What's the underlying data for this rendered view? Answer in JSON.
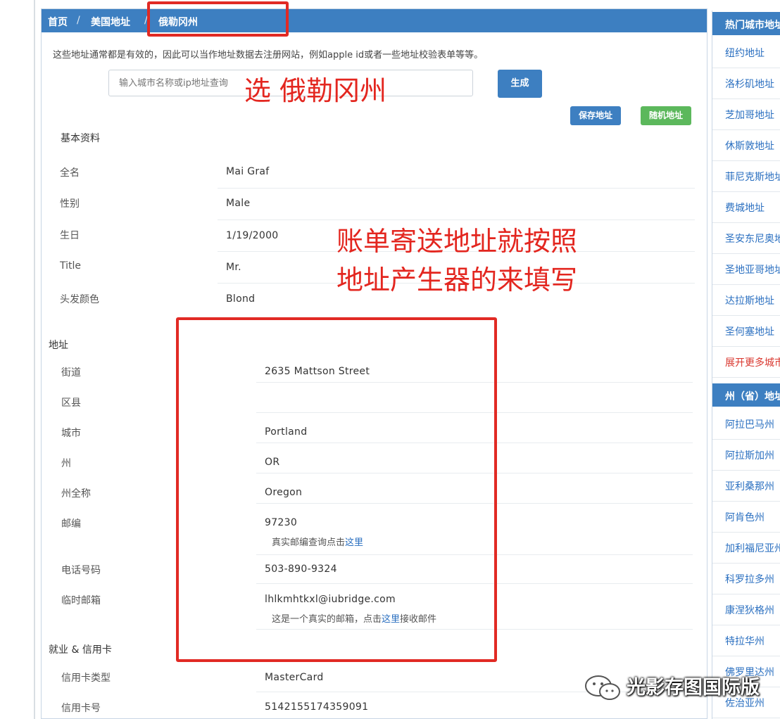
{
  "breadcrumb": {
    "home": "首页",
    "us_address": "美国地址",
    "current": "俄勒冈州",
    "sep": "/"
  },
  "intro": "这些地址通常都是有效的，因此可以当作地址数据去注册网站，例如apple id或者一些地址校验表单等等。",
  "search": {
    "placeholder": "输入城市名称或ip地址查询"
  },
  "buttons": {
    "generate": "生成",
    "save": "保存地址",
    "random": "随机地址"
  },
  "basic": {
    "title": "基本资料",
    "rows": [
      {
        "label": "全名",
        "value": "Mai Graf"
      },
      {
        "label": "性别",
        "value": "Male"
      },
      {
        "label": "生日",
        "value": "1/19/2000"
      },
      {
        "label": "Title",
        "value": "Mr."
      },
      {
        "label": "头发颜色",
        "value": "Blond"
      }
    ]
  },
  "address": {
    "title": "地址",
    "rows": [
      {
        "label": "街道",
        "value": "2635  Mattson Street"
      },
      {
        "label": "区县",
        "value": ""
      },
      {
        "label": "城市",
        "value": "Portland"
      },
      {
        "label": "州",
        "value": "OR"
      },
      {
        "label": "州全称",
        "value": "Oregon"
      },
      {
        "label": "邮编",
        "value": "97230"
      },
      {
        "label": "电话号码",
        "value": "503-890-9324"
      },
      {
        "label": "临时邮箱",
        "value": "lhlkmhtkxl@iubridge.com"
      }
    ],
    "zip_note": {
      "before": "真实邮编查询点击",
      "link": "这里",
      "after": ""
    },
    "email_note": {
      "before": "这是一个真实的邮箱，点击",
      "link": "这里",
      "after": "接收邮件"
    }
  },
  "employment": {
    "title": "就业 & 信用卡",
    "rows": [
      {
        "label": "信用卡类型",
        "value": "MasterCard"
      },
      {
        "label": "信用卡号",
        "value": "5142155174359091"
      }
    ]
  },
  "sidebar": {
    "hot_title": "热门城市地址",
    "hot_items": [
      "纽约地址",
      "洛杉矶地址",
      "芝加哥地址",
      "休斯敦地址",
      "菲尼克斯地址",
      "费城地址",
      "圣安东尼奥地址",
      "圣地亚哥地址",
      "达拉斯地址",
      "圣何塞地址"
    ],
    "hot_more": "展开更多城市",
    "state_title": "州（省）地址",
    "state_items": [
      "阿拉巴马州",
      "阿拉斯加州",
      "亚利桑那州",
      "阿肯色州",
      "加利福尼亚州",
      "科罗拉多州",
      "康涅狄格州",
      "特拉华州",
      "佛罗里达州",
      "佐治亚州"
    ]
  },
  "annotations": {
    "select_state": "选 俄勒冈州",
    "billing_line1": "账单寄送地址就按照",
    "billing_line2": "地址产生器的来填写"
  },
  "watermark": "光影存图国际版",
  "colors": {
    "primary": "#3d7fc1",
    "success": "#5cb85c",
    "annotation": "#e12a24",
    "link": "#2a6fc0"
  }
}
